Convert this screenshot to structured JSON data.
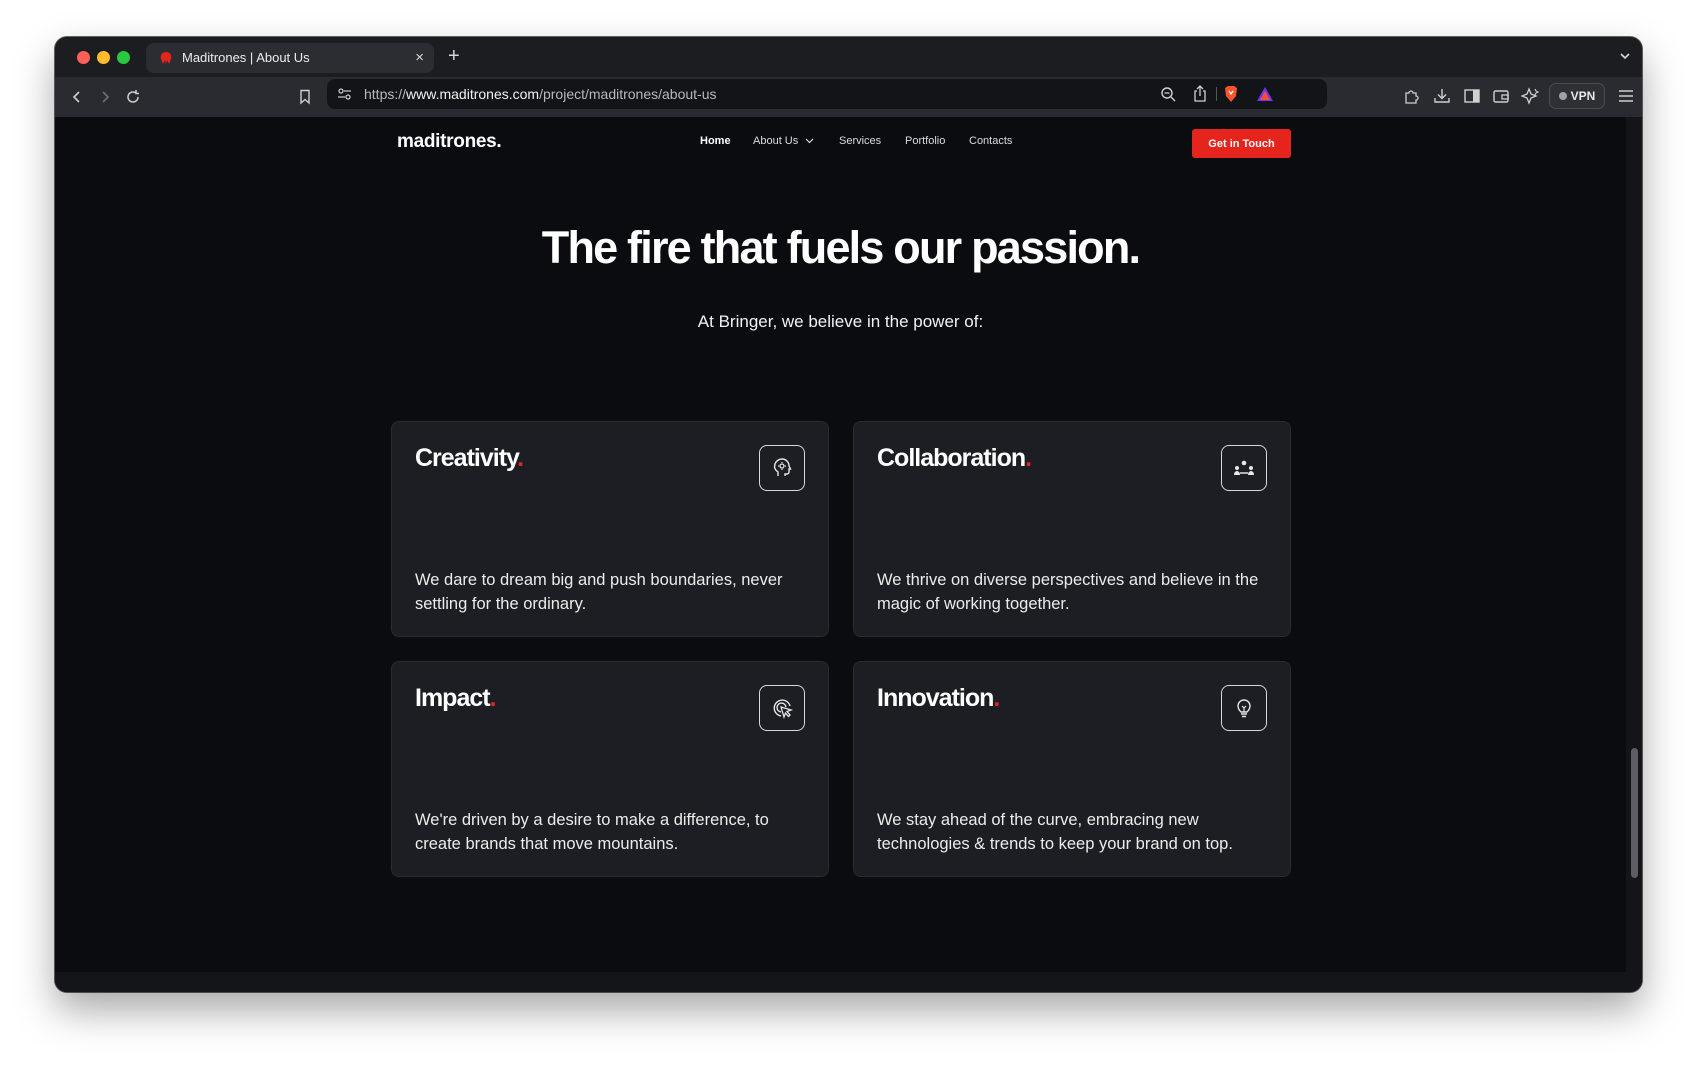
{
  "browser": {
    "tab_title": "Maditrones | About Us",
    "tab_close": "×",
    "new_tab": "+",
    "url_scheme": "https://",
    "url_host": "www.maditrones.com",
    "url_path": "/project/maditrones/about-us",
    "vpn_label": "VPN"
  },
  "nav": {
    "logo": "maditrones",
    "logo_dot": ".",
    "links": [
      "Home",
      "About Us",
      "Services",
      "Portfolio",
      "Contacts"
    ],
    "active": "Home",
    "cta": "Get in Touch"
  },
  "hero": {
    "title": "The fire that fuels our passion.",
    "subtitle": "At Bringer, we believe in the power of:"
  },
  "cards": [
    {
      "title": "Creativity",
      "accent": ".",
      "icon": "head-idea-icon",
      "text": "We dare to dream big and push boundaries, never settling for the ordinary."
    },
    {
      "title": "Collaboration",
      "accent": ".",
      "icon": "team-icon",
      "text": "We thrive on diverse perspectives and believe in the magic of working together."
    },
    {
      "title": "Impact",
      "accent": ".",
      "icon": "cursor-target-icon",
      "text": "We're driven by a desire to make a difference, to create brands that move mountains."
    },
    {
      "title": "Innovation",
      "accent": ".",
      "icon": "lightbulb-icon",
      "text": "We stay ahead of the curve, embracing new technologies & trends to keep your brand on top."
    }
  ],
  "colors": {
    "accent": "#e5241d",
    "page_bg": "#0b0c10",
    "card_bg": "#1c1e24"
  }
}
